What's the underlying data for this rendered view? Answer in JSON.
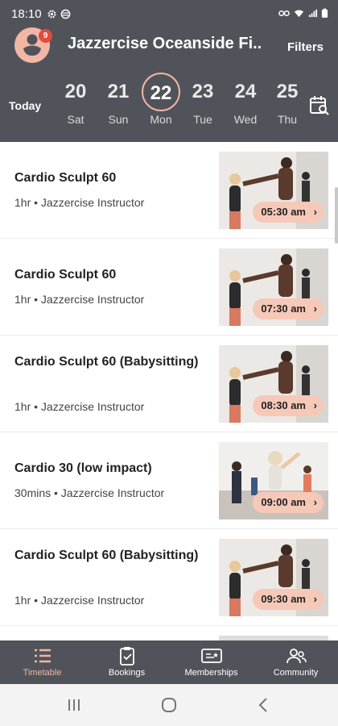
{
  "status_bar": {
    "time": "18:10",
    "icons": [
      "settings-icon",
      "at-icon",
      "vpn-icon",
      "wifi-icon",
      "signal-icon",
      "battery-icon"
    ]
  },
  "header": {
    "badge_count": "9",
    "studio_name": "Jazzercise Oceanside Fi..",
    "filters_label": "Filters",
    "today_label": "Today",
    "dates": [
      {
        "num": "20",
        "day": "Sat"
      },
      {
        "num": "21",
        "day": "Sun"
      },
      {
        "num": "22",
        "day": "Mon",
        "selected": true
      },
      {
        "num": "23",
        "day": "Tue"
      },
      {
        "num": "24",
        "day": "Wed"
      },
      {
        "num": "25",
        "day": "Thu"
      }
    ]
  },
  "classes": [
    {
      "title": "Cardio Sculpt 60",
      "meta": "1hr • Jazzercise Instructor",
      "time": "05:30 am"
    },
    {
      "title": "Cardio Sculpt 60",
      "meta": "1hr • Jazzercise Instructor",
      "time": "07:30 am"
    },
    {
      "title": "Cardio Sculpt 60 (Babysitting)",
      "meta": "1hr • Jazzercise Instructor",
      "time": "08:30 am"
    },
    {
      "title": "Cardio 30 (low impact)",
      "meta": "30mins • Jazzercise Instructor",
      "time": "09:00 am"
    },
    {
      "title": "Cardio Sculpt 60 (Babysitting)",
      "meta": "1hr • Jazzercise Instructor",
      "time": "09:30 am"
    }
  ],
  "bottom_nav": [
    {
      "label": "Timetable",
      "icon": "list-icon",
      "active": true
    },
    {
      "label": "Bookings",
      "icon": "clipboard-check-icon"
    },
    {
      "label": "Memberships",
      "icon": "membership-card-icon"
    },
    {
      "label": "Community",
      "icon": "people-icon"
    }
  ],
  "colors": {
    "header_bg": "#50545a",
    "accent": "#f2b6a4",
    "badge": "#e34b3c",
    "pill": "#f6c8b8"
  }
}
